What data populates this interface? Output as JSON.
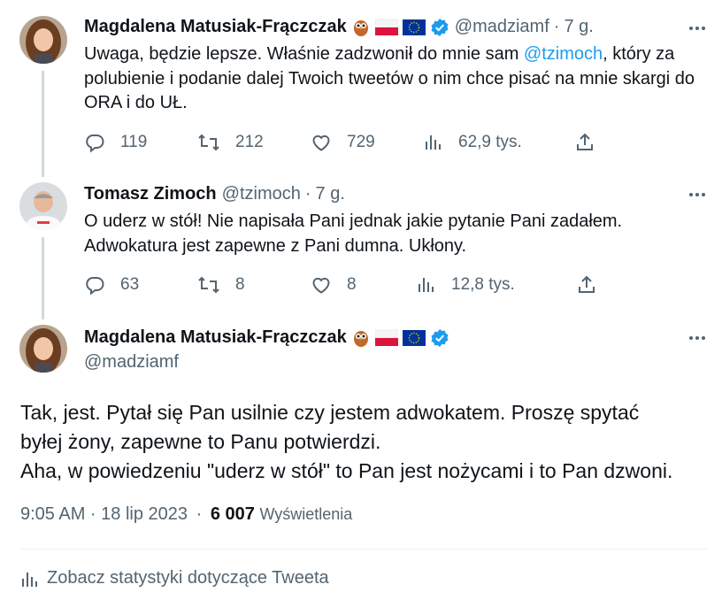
{
  "tweets": [
    {
      "name": "Magdalena Matusiak-Frączczak",
      "handle": "@madziamf",
      "sep": "·",
      "time": "7 g.",
      "text_before": "Uwaga, będzie lepsze. Właśnie zadzwonił do mnie sam ",
      "mention": "@tzimoch",
      "text_after": ", który za polubienie i podanie dalej Twoich tweetów o nim chce pisać na mnie skargi do ORA i do UŁ.",
      "replies": "119",
      "retweets": "212",
      "likes": "729",
      "views": "62,9 tys."
    },
    {
      "name": "Tomasz Zimoch",
      "handle": "@tzimoch",
      "sep": "·",
      "time": "7 g.",
      "text": "O uderz w stół! Nie napisała Pani jednak jakie pytanie Pani zadałem. Adwokatura jest zapewne z Pani dumna. Ukłony.",
      "replies": "63",
      "retweets": "8",
      "likes": "8",
      "views": "12,8 tys."
    }
  ],
  "main": {
    "name": "Magdalena Matusiak-Frączczak",
    "handle": "@madziamf",
    "text_lines": [
      "Tak, jest. Pytał się Pan usilnie czy jestem adwokatem. Proszę spytać",
      "byłej żony, zapewne to Panu potwierdzi.",
      "Aha, w powiedzeniu \"uderz w stół\" to Pan jest nożycami i to Pan dzwoni."
    ],
    "datetime": "9:05 AM · 18 lip 2023",
    "sep": "·",
    "views_count": "6 007",
    "views_label": "Wyświetlenia",
    "stats_link": "Zobacz statystyki dotyczące Tweeta"
  },
  "colors": {
    "accent": "#1d9bf0",
    "secondary_text": "#536471",
    "verified": "#1d9bf0",
    "thread_line": "#cfd9de"
  },
  "icons": [
    "reply-icon",
    "retweet-icon",
    "like-icon",
    "views-icon",
    "share-icon",
    "more-icon",
    "verified-badge-icon",
    "owl-emoji",
    "poland-flag-emoji",
    "eu-flag-emoji",
    "analytics-icon"
  ]
}
